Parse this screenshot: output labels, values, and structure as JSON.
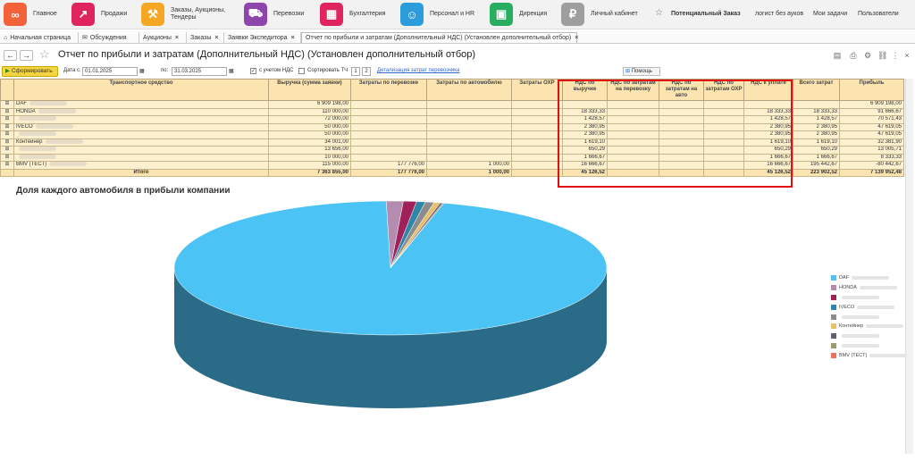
{
  "nav": [
    {
      "label": "Главное",
      "color": "#f4623a",
      "icon": "logo-icon"
    },
    {
      "label": "Продажи",
      "color": "#e0245e",
      "icon": "sales-chart-icon"
    },
    {
      "label": "Заказы, Аукционы, Тендеры",
      "color": "#f5a623",
      "icon": "auction-hammer-icon"
    },
    {
      "label": "Перевозки",
      "color": "#8e44ad",
      "icon": "truck-icon"
    },
    {
      "label": "Бухгалтерия",
      "color": "#e0245e",
      "icon": "calculator-icon"
    },
    {
      "label": "Персонал и HR",
      "color": "#2d9cdb",
      "icon": "id-card-icon"
    },
    {
      "label": "Дирекция",
      "color": "#27ae60",
      "icon": "briefcase-icon"
    },
    {
      "label": "Личный кабинет",
      "color": "#9e9e9e",
      "icon": "lock-icon"
    }
  ],
  "top_right": {
    "potential": "Потенциальный Заказ",
    "logist": "логист без ауков",
    "tasks": "Мои задачи",
    "users": "Пользователи"
  },
  "tabs": [
    "Начальная страница",
    "Обсуждения",
    "Аукционы",
    "Заказы",
    "Заявки Экспедитора",
    "Отчет по прибыли и затратам (Дополнительный НДС) (Установлен дополнительный отбор)"
  ],
  "page_title": "Отчет по прибыли и затратам (Дополнительный НДС) (Установлен дополнительный отбор)",
  "filters": {
    "form_button": "Сформировать",
    "date_from_label": "Дата с:",
    "date_from": "01.01.2025",
    "date_to_label": "по:",
    "date_to": "31.03.2025",
    "vat_label": "с учетом НДС",
    "sort_label": "Сортировать ТЧ",
    "level1": "1",
    "level2": "2",
    "detail_link": "Детализация затрат перевозчика",
    "help": "Помощь"
  },
  "table": {
    "headers": [
      "Транспортное средство",
      "Выручка (сумма заявки)",
      "Затраты по перевозке",
      "Затраты по автомобилю",
      "Затраты ОХР",
      "НДС по выручке",
      "НДС по затратам на перевозку",
      "НДС по затратам на авто",
      "НДС по затратам ОХР",
      "НДС к уплате",
      "Всего затрат",
      "Прибыль"
    ],
    "rows": [
      {
        "name": "DAF",
        "cells": [
          "6 909 198,00",
          "",
          "",
          "",
          "",
          "",
          "",
          "",
          "",
          "",
          "6 909 198,00"
        ]
      },
      {
        "name": "HONDA",
        "cells": [
          "110 000,00",
          "",
          "",
          "",
          "18 333,33",
          "",
          "",
          "",
          "18 333,33",
          "18 333,33",
          "91 666,67"
        ]
      },
      {
        "name": "",
        "cells": [
          "72 000,00",
          "",
          "",
          "",
          "1 428,57",
          "",
          "",
          "",
          "1 428,57",
          "1 428,57",
          "70 571,43"
        ]
      },
      {
        "name": "IVECO",
        "cells": [
          "50 000,00",
          "",
          "",
          "",
          "2 380,95",
          "",
          "",
          "",
          "2 380,95",
          "2 380,95",
          "47 619,05"
        ]
      },
      {
        "name": "",
        "cells": [
          "50 000,00",
          "",
          "",
          "",
          "2 380,95",
          "",
          "",
          "",
          "2 380,95",
          "2 380,95",
          "47 619,05"
        ]
      },
      {
        "name": "Контейнер",
        "cells": [
          "34 001,00",
          "",
          "",
          "",
          "1 619,10",
          "",
          "",
          "",
          "1 619,10",
          "1 619,10",
          "32 381,90"
        ]
      },
      {
        "name": "",
        "cells": [
          "13 656,00",
          "",
          "",
          "",
          "650,29",
          "",
          "",
          "",
          "650,29",
          "650,29",
          "13 005,71"
        ]
      },
      {
        "name": "",
        "cells": [
          "10 000,00",
          "",
          "",
          "",
          "1 666,67",
          "",
          "",
          "",
          "1 666,67",
          "1 666,67",
          "8 333,33"
        ]
      },
      {
        "name": "BMV (ТЕСТ)",
        "cells": [
          "115 000,00",
          "177 776,00",
          "1 000,00",
          "",
          "16 666,67",
          "",
          "",
          "",
          "16 666,67",
          "195 442,67",
          "-80 442,67"
        ]
      }
    ],
    "total": {
      "name": "Итого",
      "cells": [
        "7 363 855,00",
        "177 776,00",
        "1 000,00",
        "",
        "45 126,52",
        "",
        "",
        "",
        "45 126,52",
        "223 902,52",
        "7 139 952,48"
      ]
    }
  },
  "chart_data": {
    "type": "pie",
    "title": "Доля каждого автомобиля в прибыли компании",
    "labels": [
      "DAF",
      "HONDA",
      "",
      "IVECO",
      "",
      "Контейнер",
      "",
      "",
      "BMV (ТЕСТ)"
    ],
    "values": [
      6909198.0,
      91666.67,
      70571.43,
      47619.05,
      47619.05,
      32381.9,
      13005.71,
      8333.33,
      -80442.67
    ],
    "colors": [
      "#4cc3f5",
      "#b38cb0",
      "#a0205a",
      "#2e86a8",
      "#8c8c8c",
      "#e6c06a",
      "#6a5a7a",
      "#a09870",
      "#e8735a"
    ],
    "legend_position": "right"
  }
}
